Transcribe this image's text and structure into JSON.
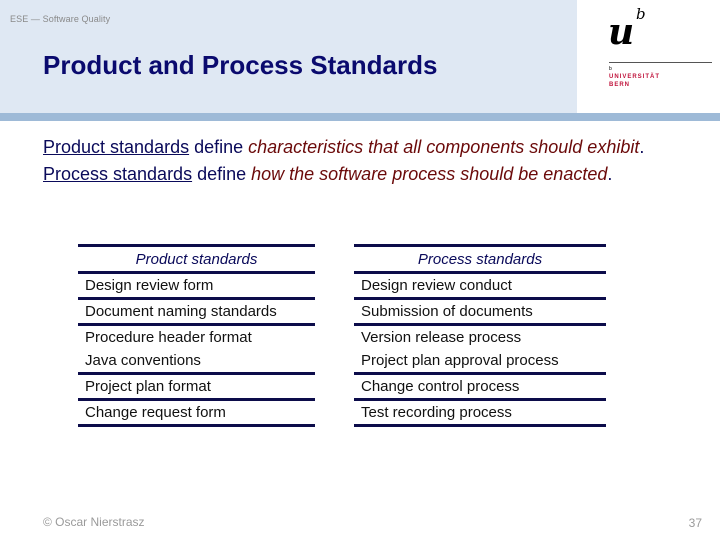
{
  "header": {
    "course_label": "ESE — Software Quality",
    "title": "Product and Process Standards"
  },
  "logo": {
    "u": "u",
    "b": "b",
    "small_b": "b",
    "university": "UNIVERSITÄT",
    "city": "BERN",
    "accent_color": "#c0143c"
  },
  "body": {
    "paragraphs": [
      {
        "term": "Product standards",
        "verb": " define ",
        "emphasis": "characteristics that all components should exhibit",
        "end": "."
      },
      {
        "term": "Process standards",
        "verb": " define ",
        "emphasis": "how the software process should be enacted",
        "end": "."
      }
    ]
  },
  "tables": {
    "product": {
      "header": "Product standards",
      "rows": [
        "Design review form",
        "Document naming standards",
        "Procedure header format",
        "Java conventions",
        "Project plan format",
        "Change request form"
      ]
    },
    "process": {
      "header": "Process standards",
      "rows": [
        "Design review conduct",
        "Submission of documents",
        "Version release process",
        "Project plan approval process",
        "Change control process",
        "Test recording process"
      ]
    }
  },
  "footer": {
    "author": "© Oscar Nierstrasz",
    "page_number": "37"
  },
  "colors": {
    "title": "#0a0a6e",
    "emphasis": "#6b0a0a",
    "header_band": "#dfe8f3",
    "header_strip": "#9ebad7",
    "table_rule": "#0c0c4a"
  }
}
